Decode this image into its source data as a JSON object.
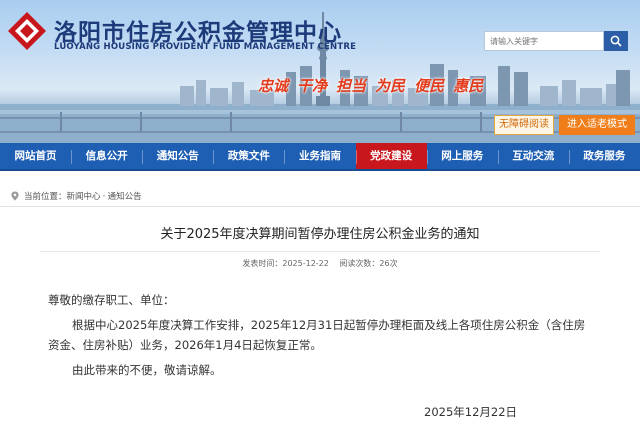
{
  "header": {
    "title": "洛阳市住房公积金管理中心",
    "subtitle": "LUOYANG HOUSING PROVIDENT FUND MANAGEMENT CENTRE",
    "search_placeholder": "请输入关键字",
    "slogans": [
      "忠诚",
      "干净",
      "担当",
      "为民",
      "便民",
      "惠民"
    ],
    "accessibility_label": "无障碍阅读",
    "elder_mode_label": "进入适老模式",
    "logo_icon": "red-diamond-logo-icon"
  },
  "nav": {
    "items": [
      "网站首页",
      "信息公开",
      "通知公告",
      "政策文件",
      "业务指南",
      "党政建设",
      "网上服务",
      "互动交流",
      "政务服务"
    ],
    "active_index": 5
  },
  "breadcrumb": {
    "label": "当前位置：",
    "items": [
      "新闻中心",
      "通知公告"
    ],
    "separator": "-"
  },
  "article": {
    "title": "关于2025年度决算期间暂停办理住房公积金业务的通知",
    "publish_time": "发表时间：2025-12-22",
    "views": "阅读次数：26次",
    "greeting": "尊敬的缴存职工、单位：",
    "para1_line1": "根据中心2025年度决算工作安排，2025年12月31日起暂停办理柜面及线上各项住房公积金（含住房",
    "para1_line2": "资金、住房补贴）业务，2026年1月4日起恢复正常。",
    "para2": "由此带来的不便，敬请谅解。",
    "date": "2025年12月22日"
  },
  "colors": {
    "nav_bg": "#1f5fb3",
    "nav_active": "#c9171e",
    "title_blue": "#1d3a7a",
    "slogan_red": "#e33b1c",
    "elder_orange": "#ef7e1a"
  }
}
